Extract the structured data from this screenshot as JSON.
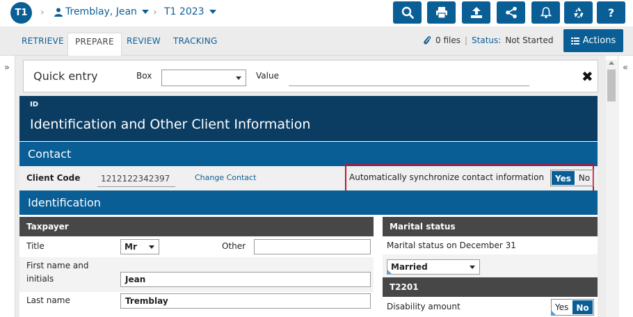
{
  "header": {
    "badge": "T1",
    "client_name": "Tremblay, Jean",
    "tax_year": "T1 2023",
    "toolbar_icons": [
      "search-icon",
      "print-icon",
      "upload-icon",
      "share-icon",
      "bell-icon",
      "recycle-icon",
      "help-icon"
    ],
    "help_label": "?"
  },
  "tabs": [
    {
      "label": "RETRIEVE",
      "active": false
    },
    {
      "label": "PREPARE",
      "active": true
    },
    {
      "label": "REVIEW",
      "active": false
    },
    {
      "label": "TRACKING",
      "active": false
    }
  ],
  "files": {
    "count_label": "0 files",
    "status_label": "Status:",
    "status_value": "Not Started"
  },
  "actions_label": "Actions",
  "quick_entry": {
    "title": "Quick entry",
    "box_label": "Box",
    "box_value": "",
    "value_label": "Value",
    "value_value": ""
  },
  "form": {
    "id_small": "ID",
    "title": "Identification and Other Client Information",
    "contact_section": "Contact",
    "client_code_label": "Client Code",
    "client_code_value": "1212122342397",
    "change_contact": "Change Contact",
    "sync_label": "Automatically synchronize contact information",
    "sync_yes": "Yes",
    "sync_no": "No",
    "sync_selected": "Yes",
    "identification_section": "Identification",
    "taxpayer": {
      "header": "Taxpayer",
      "title_label": "Title",
      "title_value": "Mr",
      "other_label": "Other",
      "other_value": "",
      "first_name_label": "First name and initials",
      "first_name_value": "Jean",
      "last_name_label": "Last name",
      "last_name_value": "Tremblay"
    },
    "marital": {
      "header": "Marital status",
      "dec31_label": "Marital status on December 31",
      "dec31_value": "Married"
    },
    "t2201": {
      "header": "T2201",
      "disability_label": "Disability amount",
      "yes": "Yes",
      "no": "No",
      "selected": "No"
    }
  },
  "colors": {
    "primary": "#0a5e96",
    "dark_header": "#0b3d63",
    "column_header": "#474747",
    "highlight_border": "#c8102e"
  }
}
